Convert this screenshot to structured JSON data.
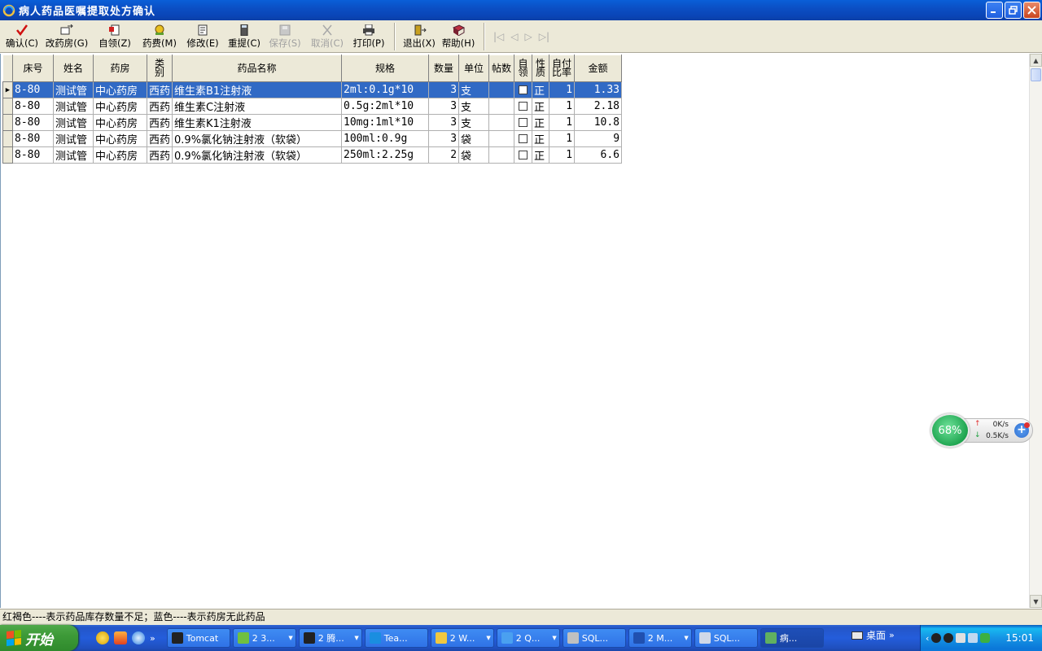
{
  "window": {
    "title": "病人药品医嘱提取处方确认"
  },
  "toolbar": {
    "buttons": [
      {
        "label": "确认(C)",
        "icon": "checkmark-icon",
        "enabled": true
      },
      {
        "label": "改药房(G)",
        "icon": "change-pharmacy-icon",
        "enabled": true
      },
      {
        "label": "自领(Z)",
        "icon": "self-collect-icon",
        "enabled": true
      },
      {
        "label": "药费(M)",
        "icon": "medicine-fee-icon",
        "enabled": true
      },
      {
        "label": "修改(E)",
        "icon": "edit-icon",
        "enabled": true
      },
      {
        "label": "重提(C)",
        "icon": "calculator-icon",
        "enabled": true
      },
      {
        "label": "保存(S)",
        "icon": "save-icon",
        "enabled": false
      },
      {
        "label": "取消(C)",
        "icon": "cancel-icon",
        "enabled": false
      },
      {
        "label": "打印(P)",
        "icon": "printer-icon",
        "enabled": true
      },
      {
        "label": "退出(X)",
        "icon": "exit-door-icon",
        "enabled": true
      },
      {
        "label": "帮助(H)",
        "icon": "help-book-icon",
        "enabled": true
      }
    ],
    "nav": [
      "|◁",
      "◁",
      "▷",
      "▷|"
    ]
  },
  "grid": {
    "columns": [
      "床号",
      "姓名",
      "药房",
      "类别",
      "药品名称",
      "规格",
      "数量",
      "单位",
      "帖数",
      "自领",
      "性质",
      "自付比率",
      "金额"
    ],
    "rows": [
      {
        "bed": "8-80",
        "name": "测试管",
        "pharmacy": "中心药房",
        "category": "西药",
        "drug": "维生素B1注射液",
        "spec": "2ml:0.1g*10",
        "qty": "3",
        "unit": "支",
        "doses": "",
        "self": false,
        "nature": "正",
        "ratio": "1",
        "amount": "1.33",
        "selected": true
      },
      {
        "bed": "8-80",
        "name": "测试管",
        "pharmacy": "中心药房",
        "category": "西药",
        "drug": "维生素C注射液",
        "spec": "0.5g:2ml*10",
        "qty": "3",
        "unit": "支",
        "doses": "",
        "self": false,
        "nature": "正",
        "ratio": "1",
        "amount": "2.18",
        "selected": false
      },
      {
        "bed": "8-80",
        "name": "测试管",
        "pharmacy": "中心药房",
        "category": "西药",
        "drug": "维生素K1注射液",
        "spec": "10mg:1ml*10",
        "qty": "3",
        "unit": "支",
        "doses": "",
        "self": false,
        "nature": "正",
        "ratio": "1",
        "amount": "10.8",
        "selected": false
      },
      {
        "bed": "8-80",
        "name": "测试管",
        "pharmacy": "中心药房",
        "category": "西药",
        "drug": "0.9%氯化钠注射液（软袋）",
        "spec": "100ml:0.9g",
        "qty": "3",
        "unit": "袋",
        "doses": "",
        "self": false,
        "nature": "正",
        "ratio": "1",
        "amount": "9",
        "selected": false
      },
      {
        "bed": "8-80",
        "name": "测试管",
        "pharmacy": "中心药房",
        "category": "西药",
        "drug": "0.9%氯化钠注射液（软袋）",
        "spec": "250ml:2.25g",
        "qty": "2",
        "unit": "袋",
        "doses": "",
        "self": false,
        "nature": "正",
        "ratio": "1",
        "amount": "6.6",
        "selected": false
      }
    ]
  },
  "status": {
    "text": "红褐色----表示药品库存数量不足；蓝色----表示药房无此药品"
  },
  "net_widget": {
    "percent": "68%",
    "up": "0K/s",
    "down": "0.5K/s"
  },
  "taskbar": {
    "start_label": "开始",
    "tasks": [
      {
        "label": "Tomcat",
        "icon": "console-icon",
        "active": false,
        "dropdown": false
      },
      {
        "label": "2 3...",
        "icon": "browser-icon",
        "active": false,
        "dropdown": true
      },
      {
        "label": "2 腾...",
        "icon": "qq-icon",
        "active": false,
        "dropdown": true
      },
      {
        "label": "Tea...",
        "icon": "teamviewer-icon",
        "active": false,
        "dropdown": false
      },
      {
        "label": "2 W...",
        "icon": "folder-icon",
        "active": false,
        "dropdown": true
      },
      {
        "label": "2 Q...",
        "icon": "search-icon",
        "active": false,
        "dropdown": true
      },
      {
        "label": "SQL...",
        "icon": "gear-icon",
        "active": false,
        "dropdown": false
      },
      {
        "label": "2 M...",
        "icon": "word-icon",
        "active": false,
        "dropdown": true
      },
      {
        "label": "SQL...",
        "icon": "sql-icon",
        "active": false,
        "dropdown": false
      },
      {
        "label": "病...",
        "icon": "app-icon",
        "active": true,
        "dropdown": false
      }
    ],
    "desktop_label": "桌面",
    "clock": "15:01"
  }
}
